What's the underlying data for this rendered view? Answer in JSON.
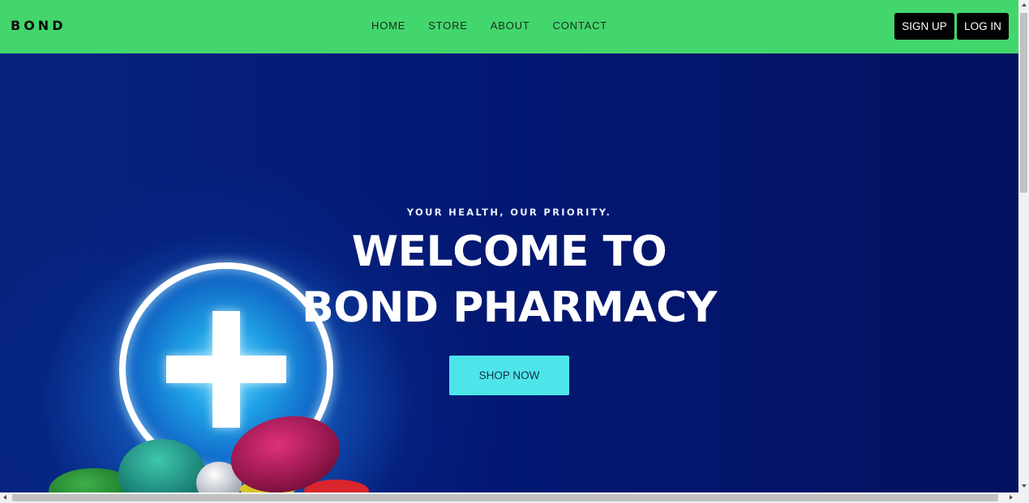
{
  "navbar": {
    "logo": "BOND",
    "links": [
      "HOME",
      "STORE",
      "ABOUT",
      "CONTACT"
    ],
    "signup_label": "SIGN UP",
    "login_label": "LOG IN",
    "background_color": "#43d66d"
  },
  "hero": {
    "tagline": "YOUR HEALTH, OUR PRIORITY.",
    "headline_line1": "WELCOME TO",
    "headline_line2": "BOND PHARMACY",
    "cta_label": "SHOP NOW",
    "cta_color": "#4ee5ea",
    "background_color": "#041c78",
    "image_icons": [
      "medical-cross-icon",
      "pills-icon"
    ]
  }
}
